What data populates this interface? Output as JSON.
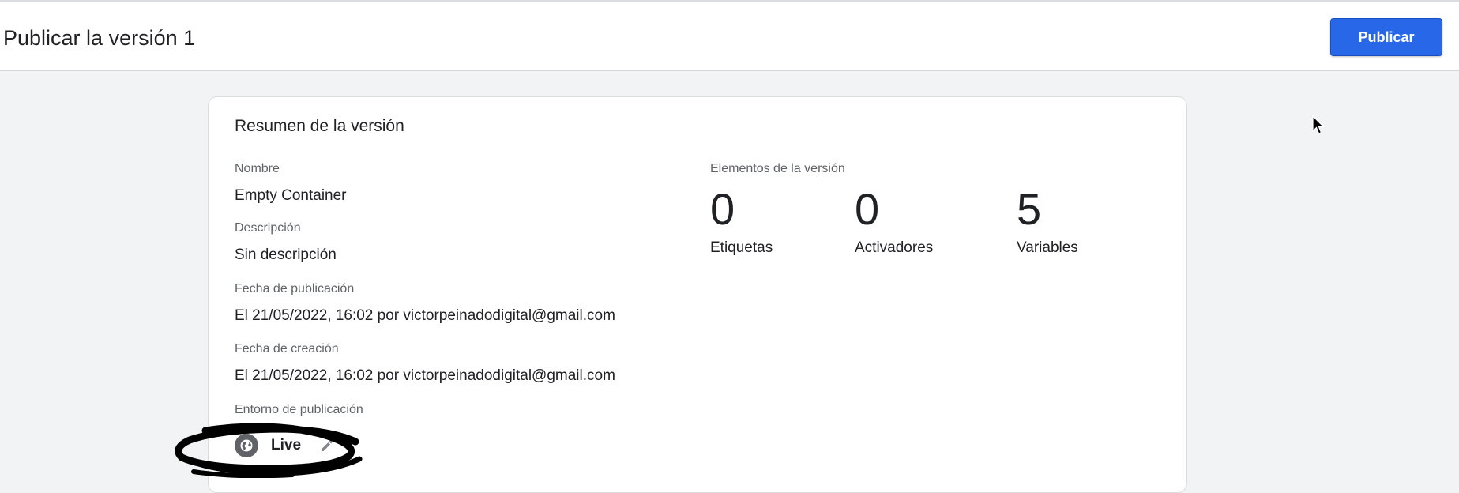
{
  "header": {
    "title": "Publicar la versión 1",
    "publish_label": "Publicar"
  },
  "summary": {
    "title": "Resumen de la versión",
    "fields": {
      "name_label": "Nombre",
      "name_value": "Empty Container",
      "description_label": "Descripción",
      "description_value": "Sin descripción",
      "published_label": "Fecha de publicación",
      "published_value": "El 21/05/2022, 16:02 por victorpeinadodigital@gmail.com",
      "created_label": "Fecha de creación",
      "created_value": "El 21/05/2022, 16:02 por victorpeinadodigital@gmail.com",
      "environment_label": "Entorno de publicación",
      "environment_value": "Live"
    },
    "elements": {
      "label": "Elementos de la versión",
      "tags_count": "0",
      "tags_label": "Etiquetas",
      "triggers_count": "0",
      "triggers_label": "Activadores",
      "variables_count": "5",
      "variables_label": "Variables"
    }
  },
  "icons": {
    "environment": "globe-icon",
    "edit": "pencil-icon",
    "cursor": "mouse-pointer-icon"
  },
  "colors": {
    "primary_button": "#2867e8",
    "background": "#f1f3f4",
    "card": "#ffffff",
    "annotation": "#000000"
  }
}
